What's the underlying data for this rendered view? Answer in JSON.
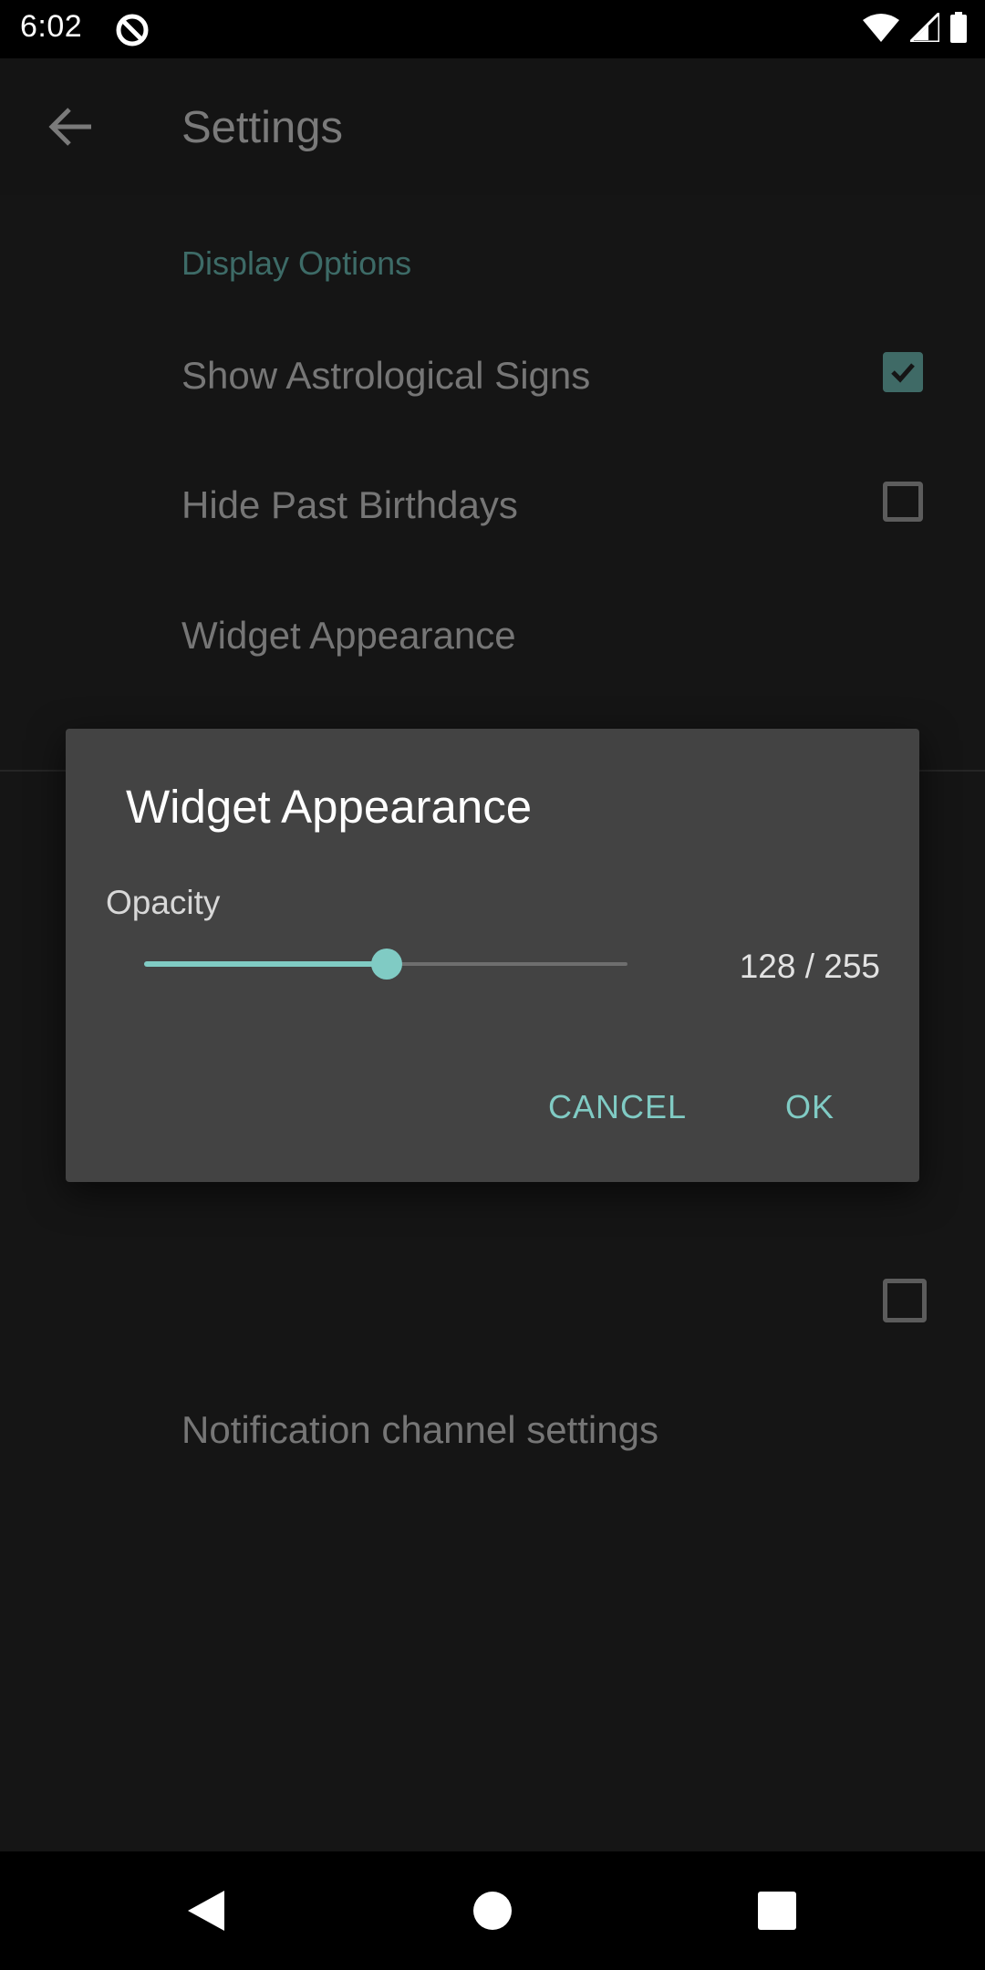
{
  "status_bar": {
    "time": "6:02",
    "icons": [
      "data-saver-icon",
      "wifi-icon",
      "signal-icon",
      "battery-icon"
    ]
  },
  "app_bar": {
    "title": "Settings",
    "back_icon": "arrow-back-icon"
  },
  "settings": {
    "section_header": "Display Options",
    "items": [
      {
        "label": "Show Astrological Signs",
        "checked": true
      },
      {
        "label": "Hide Past Birthdays",
        "checked": false
      },
      {
        "label": "Widget Appearance"
      }
    ],
    "notification_item": "Notification channel settings"
  },
  "dialog": {
    "title": "Widget Appearance",
    "opacity_label": "Opacity",
    "slider": {
      "value": 128,
      "max": 255
    },
    "value_text": "128 / 255",
    "cancel_label": "CANCEL",
    "ok_label": "OK"
  },
  "colors": {
    "accent": "#80cbc4",
    "dialog_bg": "#434343",
    "screen_bg": "#151515"
  },
  "nav_bar": {
    "icons": [
      "back-triangle-icon",
      "home-circle-icon",
      "recents-square-icon"
    ]
  }
}
